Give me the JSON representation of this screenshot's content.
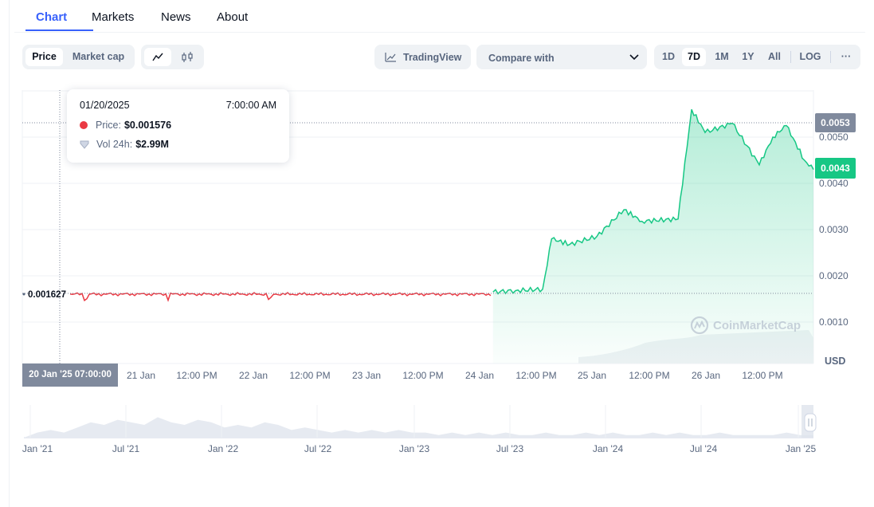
{
  "tabs": [
    {
      "label": "Chart",
      "active": true
    },
    {
      "label": "Markets",
      "active": false
    },
    {
      "label": "News",
      "active": false
    },
    {
      "label": "About",
      "active": false
    }
  ],
  "toolbar": {
    "metric_options": [
      "Price",
      "Market cap"
    ],
    "metric_selected": "Price",
    "chart_modes": [
      "line-chart-icon",
      "candlestick-icon"
    ],
    "tradingview_label": "TradingView",
    "compare_placeholder": "Compare with",
    "ranges": [
      "1D",
      "7D",
      "1M",
      "1Y",
      "All"
    ],
    "range_selected": "7D",
    "log_label": "LOG",
    "more_label": "···"
  },
  "tooltip": {
    "date": "01/20/2025",
    "time": "7:00:00 AM",
    "price_label": "Price:",
    "price_value": "$0.001576",
    "vol_label": "Vol 24h:",
    "vol_value": "$2.99M",
    "price_color": "#ea3943",
    "vol_icon": "volume-shield-icon"
  },
  "chart_data": {
    "type": "line",
    "series": [
      {
        "name": "Price",
        "x": [
          "2025-01-20T07:00",
          "2025-01-20T12:00",
          "2025-01-21T00:00",
          "2025-01-21T12:00",
          "2025-01-22T00:00",
          "2025-01-22T12:00",
          "2025-01-23T00:00",
          "2025-01-23T12:00",
          "2025-01-24T00:00",
          "2025-01-24T07:00",
          "2025-01-24T12:00",
          "2025-01-24T18:00",
          "2025-01-24T20:00",
          "2025-01-25T00:00",
          "2025-01-25T06:00",
          "2025-01-25T12:00",
          "2025-01-25T16:00",
          "2025-01-26T00:00",
          "2025-01-26T03:00",
          "2025-01-26T06:00",
          "2025-01-26T12:00",
          "2025-01-26T18:00",
          "2025-01-26T21:00",
          "2025-01-27T00:00",
          "2025-01-27T04:00",
          "2025-01-27T06:00"
        ],
        "values": [
          0.001576,
          0.00159,
          0.00158,
          0.00159,
          0.00159,
          0.00158,
          0.00157,
          0.00157,
          0.00158,
          0.00165,
          0.00168,
          0.00171,
          0.0028,
          0.00268,
          0.00285,
          0.00343,
          0.00318,
          0.00323,
          0.0056,
          0.0051,
          0.0053,
          0.0044,
          0.005,
          0.00525,
          0.0045,
          0.0043
        ]
      }
    ],
    "reference_price": "0.001627",
    "current_price_label": "0.0043",
    "hover_price_label": "0.0053",
    "ylim": [
      0,
      0.0062
    ],
    "yticks": [
      "0.0010",
      "0.0020",
      "0.0030",
      "0.0040",
      "0.0050"
    ],
    "ylabel": "USD",
    "xticks": [
      "21 Jan",
      "12:00 PM",
      "22 Jan",
      "12:00 PM",
      "23 Jan",
      "12:00 PM",
      "24 Jan",
      "12:00 PM",
      "25 Jan",
      "12:00 PM",
      "26 Jan",
      "12:00 PM"
    ],
    "crosshair_label": "20 Jan '25 07:00:00",
    "colors": {
      "down": "#ea3943",
      "up": "#16c784",
      "grid": "#eff2f5",
      "badge": "#808a9d"
    },
    "navigator_ticks": [
      "Jan '21",
      "Jul '21",
      "Jan '22",
      "Jul '22",
      "Jan '23",
      "Jul '23",
      "Jan '24",
      "Jul '24",
      "Jan '25"
    ],
    "navigator_volume": [
      0,
      2,
      3,
      2,
      4,
      6,
      5,
      7,
      6,
      5,
      8,
      6,
      5,
      7,
      6,
      4,
      5,
      4,
      6,
      5,
      3,
      4,
      3,
      2,
      3,
      2,
      3,
      2,
      3,
      2,
      2,
      1,
      2,
      1,
      2,
      1,
      2,
      1,
      1,
      2,
      1,
      1,
      2,
      1,
      2,
      1,
      1,
      2,
      1,
      2,
      1,
      1,
      2,
      1,
      1,
      1,
      1,
      2,
      1,
      1
    ],
    "watermark": "CoinMarketCap"
  }
}
